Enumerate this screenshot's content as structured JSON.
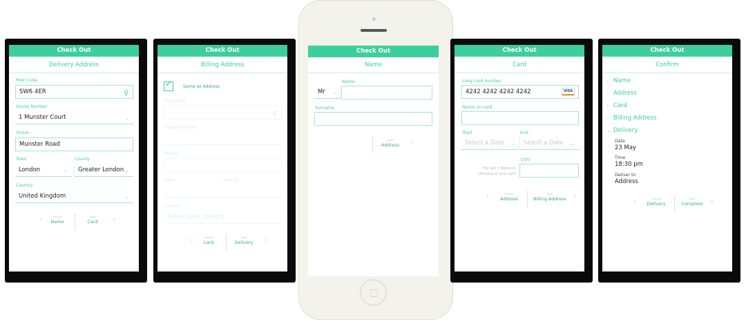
{
  "common": {
    "header": "Check Out",
    "small_previous": "Previous",
    "small_next": "Next"
  },
  "s1": {
    "title": "Delivery Address",
    "postcode_label": "Post Code",
    "postcode_value": "SW6 4ER",
    "house_label": "House Number",
    "house_value": "1 Munster Court",
    "street_label": "Street",
    "street_value": "Munster Road",
    "town_label": "Town",
    "town_value": "London",
    "county_label": "County",
    "county_value": "Greater London",
    "country_label": "Country",
    "country_value": "United Kingdom",
    "prev": "Name",
    "next": "Card"
  },
  "s2": {
    "title": "Billing Address",
    "same_label": "Same as Address",
    "same_checked": true,
    "postcode_label": "Post Code",
    "house_label": "House Number",
    "street_label": "Street",
    "town_label": "Town",
    "county_label": "County",
    "country_label": "Country",
    "country_placeholder": "Select your country",
    "prev": "Card",
    "next": "Delivery"
  },
  "s3": {
    "title": "Name",
    "name_label": "Name",
    "title_value": "Mr",
    "surname_label": "Surname",
    "next": "Address"
  },
  "s4": {
    "title": "Card",
    "card_label": "Long card number",
    "card_value": "4242 4242 4242 4242",
    "card_brand": "VISA",
    "name_label": "Name on card",
    "start_label": "Start",
    "end_label": "End",
    "start_placeholder": "Select a Date",
    "end_placeholder": "Select a Date",
    "cvv_label": "CVV",
    "cvv_hint_1": "The last 3 digits on",
    "cvv_hint_2": "the back of your card",
    "prev": "Address",
    "next": "Billing Address"
  },
  "s5": {
    "title": "Confirm",
    "items": [
      {
        "label": "Name"
      },
      {
        "label": "Address"
      },
      {
        "label": "Card"
      },
      {
        "label": "Billing Address"
      },
      {
        "label": "Delivery"
      }
    ],
    "date_label": "Date",
    "date_value": "23 May",
    "time_label": "Time",
    "time_value": "18:30 pm",
    "deliver_label": "Deliver to",
    "deliver_value": "Address",
    "prev": "Delivery",
    "next": "Complete"
  },
  "colors": {
    "accent": "#3dcf9b",
    "device_frame": "#0a0a0a",
    "phone_body": "#f3f2eb"
  }
}
